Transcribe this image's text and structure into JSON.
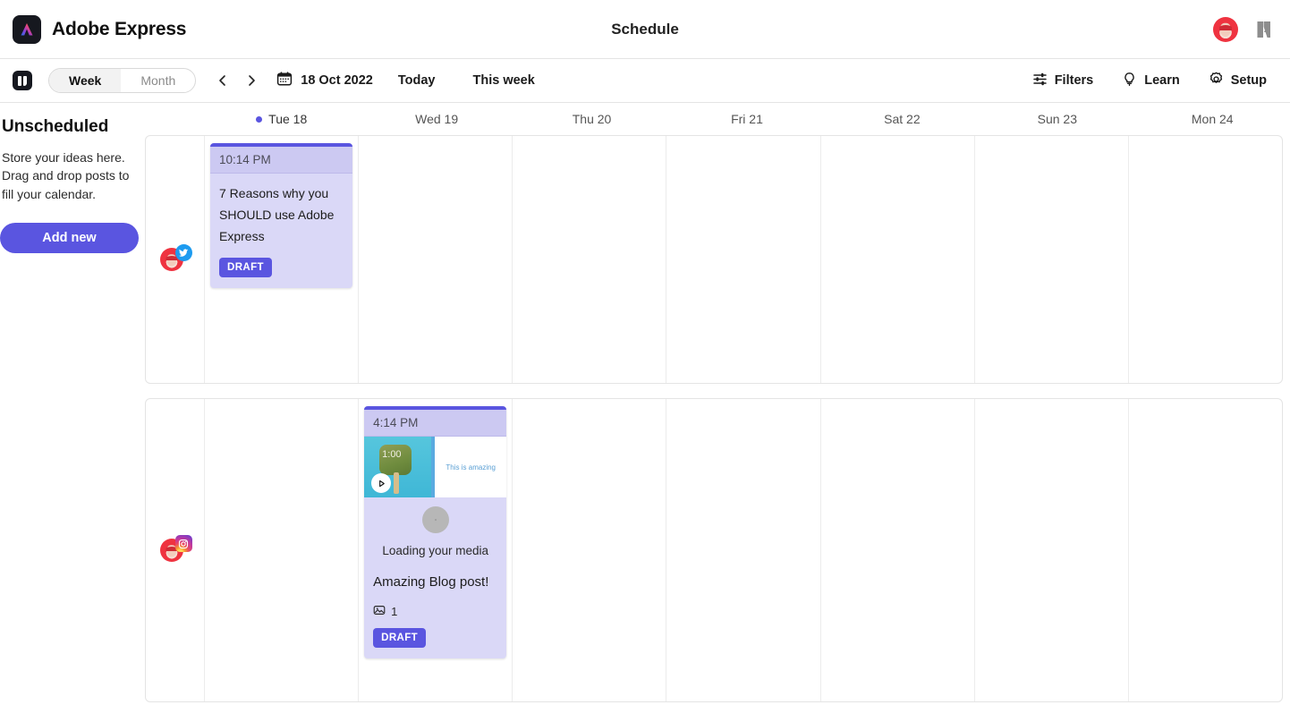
{
  "header": {
    "brand_name": "Adobe Express",
    "title": "Schedule",
    "logo_icon": "adobe-express-logo",
    "user_avatar_icon": "user-avatar",
    "adobe_icon": "adobe-logo"
  },
  "toolbar": {
    "panel_toggle_icon": "panel-toggle-icon",
    "view_week": "Week",
    "view_month": "Month",
    "active_view": "Week",
    "prev_icon": "chevron-left-icon",
    "next_icon": "chevron-right-icon",
    "calendar_icon": "calendar-icon",
    "date_label": "18 Oct 2022",
    "today_label": "Today",
    "this_week_label": "This week",
    "filters_label": "Filters",
    "filters_icon": "sliders-icon",
    "learn_label": "Learn",
    "learn_icon": "lightbulb-icon",
    "setup_label": "Setup",
    "setup_icon": "gear-icon"
  },
  "sidebar": {
    "title": "Unscheduled",
    "description": "Store your ideas here. Drag and drop posts to fill your calendar.",
    "add_new_label": "Add new"
  },
  "calendar": {
    "days": [
      {
        "label": "Tue 18",
        "is_today": true
      },
      {
        "label": "Wed 19",
        "is_today": false
      },
      {
        "label": "Thu 20",
        "is_today": false
      },
      {
        "label": "Fri 21",
        "is_today": false
      },
      {
        "label": "Sat 22",
        "is_today": false
      },
      {
        "label": "Sun 23",
        "is_today": false
      },
      {
        "label": "Mon 24",
        "is_today": false
      }
    ],
    "rows": [
      {
        "network": "twitter",
        "network_icon": "twitter-icon",
        "avatar_icon": "user-avatar",
        "post": {
          "day_index": 0,
          "time": "10:14 PM",
          "text": "7 Reasons why you SHOULD use Adobe Express",
          "status": "DRAFT"
        }
      },
      {
        "network": "instagram",
        "network_icon": "instagram-icon",
        "avatar_icon": "user-avatar",
        "post": {
          "day_index": 1,
          "time": "4:14 PM",
          "video_duration": "1:00",
          "note_text": "This is amazing",
          "loading_text": "Loading your media",
          "title": "Amazing Blog post!",
          "attachment_count": "1",
          "attachment_icon": "image-icon",
          "play_icon": "play-icon",
          "status": "DRAFT"
        }
      }
    ]
  },
  "colors": {
    "accent": "#5a55e0",
    "card_bg": "#dad8f7",
    "card_header_bg": "#ccc9f2",
    "brand_dark": "#16181f"
  }
}
